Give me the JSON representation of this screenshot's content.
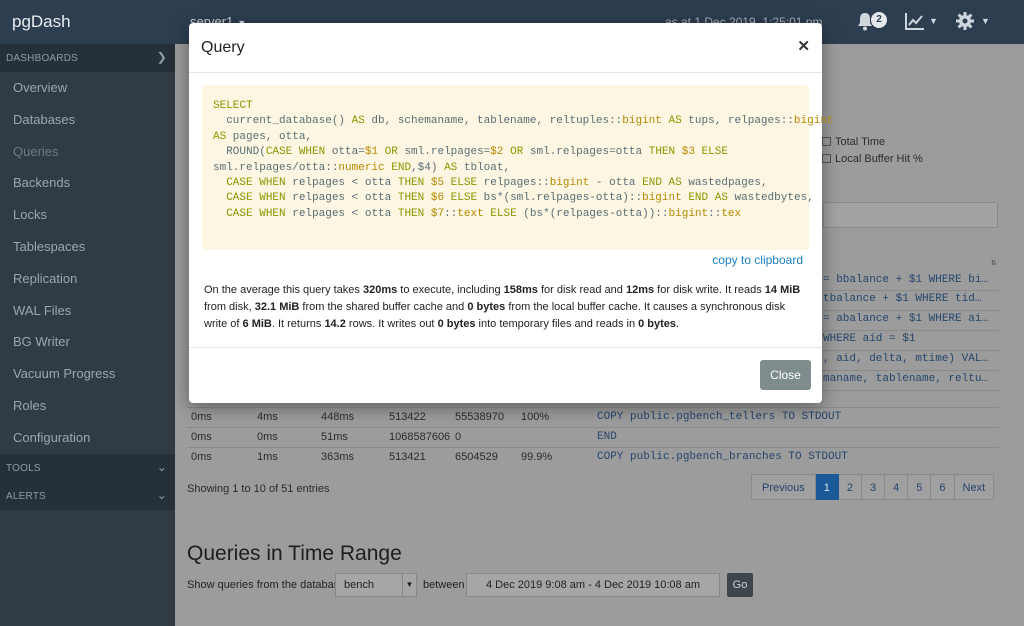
{
  "topbar": {
    "brand": "pgDash",
    "server": "server1",
    "as_of": "as at 1 Dec 2019, 1:25:01 pm",
    "notifications_count": "2"
  },
  "sidebar": {
    "dashboards_header": "DASHBOARDS",
    "items": [
      {
        "label": "Overview"
      },
      {
        "label": "Databases"
      },
      {
        "label": "Queries"
      },
      {
        "label": "Backends"
      },
      {
        "label": "Locks"
      },
      {
        "label": "Tablespaces"
      },
      {
        "label": "Replication"
      },
      {
        "label": "WAL Files"
      },
      {
        "label": "BG Writer"
      },
      {
        "label": "Vacuum Progress"
      },
      {
        "label": "Roles"
      },
      {
        "label": "Configuration"
      }
    ],
    "tools_header": "TOOLS",
    "alerts_header": "ALERTS"
  },
  "main": {
    "legend": [
      "Total Time",
      "Local Buffer Hit %"
    ],
    "partial_queries": [
      "= bbalance + $1 WHERE bi…",
      "tbalance + $1 WHERE tid…",
      "= abalance + $1 WHERE ai…",
      "WHERE aid = $1",
      ", aid, delta, mtime) VAL…",
      "maname, tablename, reltu…"
    ],
    "rows": [
      {
        "c1": "0ms",
        "c2": "4ms",
        "c3": "448ms",
        "c4": "513422",
        "c5": "55538970",
        "c6": "100%",
        "query": "COPY public.pgbench_tellers TO STDOUT"
      },
      {
        "c1": "0ms",
        "c2": "0ms",
        "c3": "51ms",
        "c4": "1068587606",
        "c5": "0",
        "c6": "",
        "query": "END"
      },
      {
        "c1": "0ms",
        "c2": "1ms",
        "c3": "363ms",
        "c4": "513421",
        "c5": "6504529",
        "c6": "99.9%",
        "query": "COPY public.pgbench_branches TO STDOUT"
      }
    ],
    "showing": "Showing 1 to 10 of 51 entries",
    "pager": [
      "Previous",
      "1",
      "2",
      "3",
      "4",
      "5",
      "6",
      "Next"
    ],
    "range_heading": "Queries in Time Range",
    "filter_label": "Show queries from the database",
    "db_value": "bench",
    "between_label": "between",
    "date_range": "4 Dec 2019 9:08 am - 4 Dec 2019 10:08 am",
    "go_label": "Go"
  },
  "modal": {
    "title": "Query",
    "copy_label": "copy to clipboard",
    "description": {
      "t1": "On the average this query takes ",
      "avg_time": "320ms",
      "t2": " to execute, including ",
      "disk_read_time": "158ms",
      "t3": " for disk read and ",
      "disk_write_time": "12ms",
      "t4": " for disk write. It reads ",
      "read_disk": "14 MiB",
      "t5": " from disk, ",
      "shared_cache": "32.1 MiB",
      "t6": " from the shared buffer cache and ",
      "local_cache": "0 bytes",
      "t7": " from the local buffer cache. It causes a synchronous disk write of ",
      "sync_write": "6 MiB",
      "t8": ". It returns ",
      "rows": "14.2",
      "t9": " rows. It writes out ",
      "temp_write": "0 bytes",
      "t10": " into temporary files and reads in ",
      "temp_read": "0 bytes",
      "t11": "."
    },
    "close_label": "Close"
  },
  "colors": {
    "topbar": "#2c3e50",
    "sidebar": "#303b44",
    "code_bg": "#fdf6e3",
    "keyword": "#859900",
    "link": "#1a7fc1",
    "close_button": "#7f8c8d"
  }
}
